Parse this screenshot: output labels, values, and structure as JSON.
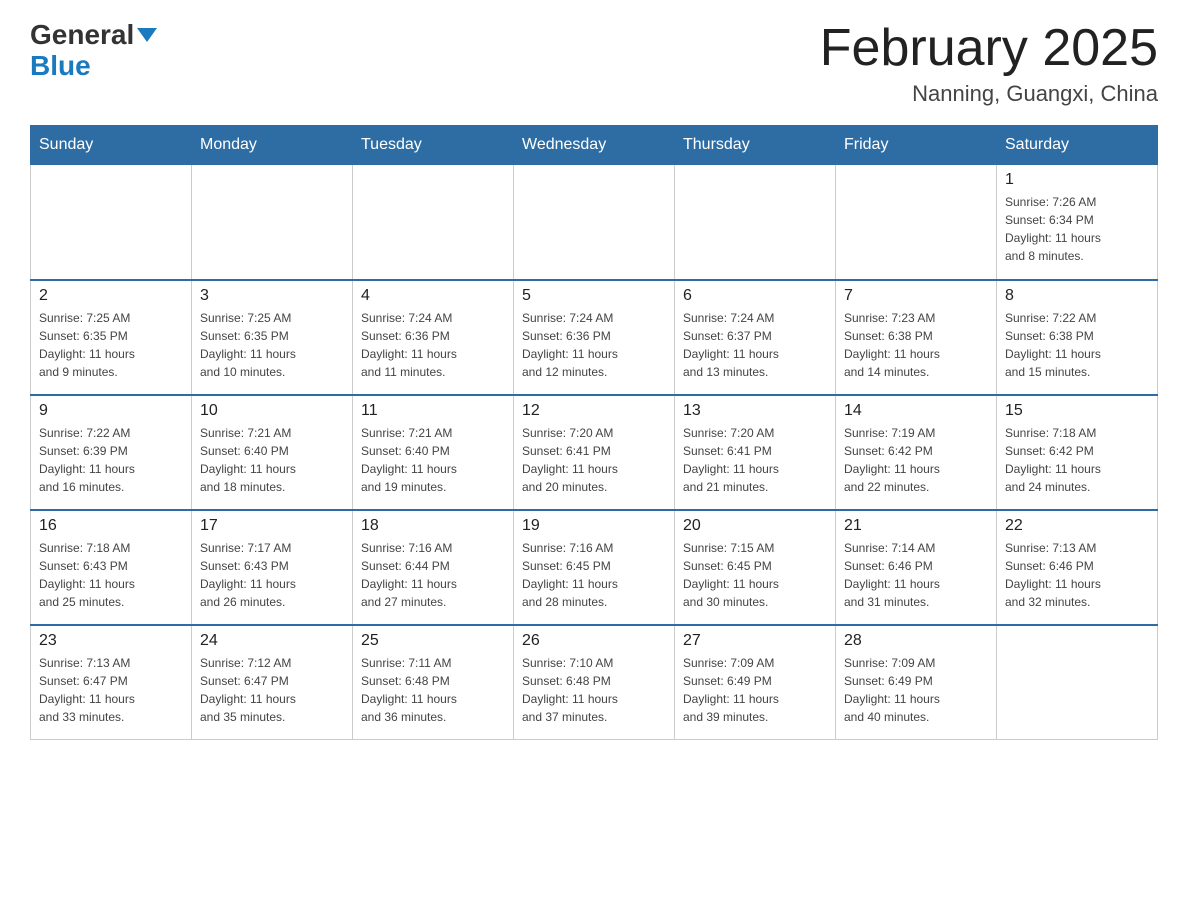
{
  "header": {
    "logo_general": "General",
    "logo_blue": "Blue",
    "title": "February 2025",
    "subtitle": "Nanning, Guangxi, China"
  },
  "days_of_week": [
    "Sunday",
    "Monday",
    "Tuesday",
    "Wednesday",
    "Thursday",
    "Friday",
    "Saturday"
  ],
  "weeks": [
    [
      {
        "day": "",
        "info": ""
      },
      {
        "day": "",
        "info": ""
      },
      {
        "day": "",
        "info": ""
      },
      {
        "day": "",
        "info": ""
      },
      {
        "day": "",
        "info": ""
      },
      {
        "day": "",
        "info": ""
      },
      {
        "day": "1",
        "info": "Sunrise: 7:26 AM\nSunset: 6:34 PM\nDaylight: 11 hours\nand 8 minutes."
      }
    ],
    [
      {
        "day": "2",
        "info": "Sunrise: 7:25 AM\nSunset: 6:35 PM\nDaylight: 11 hours\nand 9 minutes."
      },
      {
        "day": "3",
        "info": "Sunrise: 7:25 AM\nSunset: 6:35 PM\nDaylight: 11 hours\nand 10 minutes."
      },
      {
        "day": "4",
        "info": "Sunrise: 7:24 AM\nSunset: 6:36 PM\nDaylight: 11 hours\nand 11 minutes."
      },
      {
        "day": "5",
        "info": "Sunrise: 7:24 AM\nSunset: 6:36 PM\nDaylight: 11 hours\nand 12 minutes."
      },
      {
        "day": "6",
        "info": "Sunrise: 7:24 AM\nSunset: 6:37 PM\nDaylight: 11 hours\nand 13 minutes."
      },
      {
        "day": "7",
        "info": "Sunrise: 7:23 AM\nSunset: 6:38 PM\nDaylight: 11 hours\nand 14 minutes."
      },
      {
        "day": "8",
        "info": "Sunrise: 7:22 AM\nSunset: 6:38 PM\nDaylight: 11 hours\nand 15 minutes."
      }
    ],
    [
      {
        "day": "9",
        "info": "Sunrise: 7:22 AM\nSunset: 6:39 PM\nDaylight: 11 hours\nand 16 minutes."
      },
      {
        "day": "10",
        "info": "Sunrise: 7:21 AM\nSunset: 6:40 PM\nDaylight: 11 hours\nand 18 minutes."
      },
      {
        "day": "11",
        "info": "Sunrise: 7:21 AM\nSunset: 6:40 PM\nDaylight: 11 hours\nand 19 minutes."
      },
      {
        "day": "12",
        "info": "Sunrise: 7:20 AM\nSunset: 6:41 PM\nDaylight: 11 hours\nand 20 minutes."
      },
      {
        "day": "13",
        "info": "Sunrise: 7:20 AM\nSunset: 6:41 PM\nDaylight: 11 hours\nand 21 minutes."
      },
      {
        "day": "14",
        "info": "Sunrise: 7:19 AM\nSunset: 6:42 PM\nDaylight: 11 hours\nand 22 minutes."
      },
      {
        "day": "15",
        "info": "Sunrise: 7:18 AM\nSunset: 6:42 PM\nDaylight: 11 hours\nand 24 minutes."
      }
    ],
    [
      {
        "day": "16",
        "info": "Sunrise: 7:18 AM\nSunset: 6:43 PM\nDaylight: 11 hours\nand 25 minutes."
      },
      {
        "day": "17",
        "info": "Sunrise: 7:17 AM\nSunset: 6:43 PM\nDaylight: 11 hours\nand 26 minutes."
      },
      {
        "day": "18",
        "info": "Sunrise: 7:16 AM\nSunset: 6:44 PM\nDaylight: 11 hours\nand 27 minutes."
      },
      {
        "day": "19",
        "info": "Sunrise: 7:16 AM\nSunset: 6:45 PM\nDaylight: 11 hours\nand 28 minutes."
      },
      {
        "day": "20",
        "info": "Sunrise: 7:15 AM\nSunset: 6:45 PM\nDaylight: 11 hours\nand 30 minutes."
      },
      {
        "day": "21",
        "info": "Sunrise: 7:14 AM\nSunset: 6:46 PM\nDaylight: 11 hours\nand 31 minutes."
      },
      {
        "day": "22",
        "info": "Sunrise: 7:13 AM\nSunset: 6:46 PM\nDaylight: 11 hours\nand 32 minutes."
      }
    ],
    [
      {
        "day": "23",
        "info": "Sunrise: 7:13 AM\nSunset: 6:47 PM\nDaylight: 11 hours\nand 33 minutes."
      },
      {
        "day": "24",
        "info": "Sunrise: 7:12 AM\nSunset: 6:47 PM\nDaylight: 11 hours\nand 35 minutes."
      },
      {
        "day": "25",
        "info": "Sunrise: 7:11 AM\nSunset: 6:48 PM\nDaylight: 11 hours\nand 36 minutes."
      },
      {
        "day": "26",
        "info": "Sunrise: 7:10 AM\nSunset: 6:48 PM\nDaylight: 11 hours\nand 37 minutes."
      },
      {
        "day": "27",
        "info": "Sunrise: 7:09 AM\nSunset: 6:49 PM\nDaylight: 11 hours\nand 39 minutes."
      },
      {
        "day": "28",
        "info": "Sunrise: 7:09 AM\nSunset: 6:49 PM\nDaylight: 11 hours\nand 40 minutes."
      },
      {
        "day": "",
        "info": ""
      }
    ]
  ]
}
